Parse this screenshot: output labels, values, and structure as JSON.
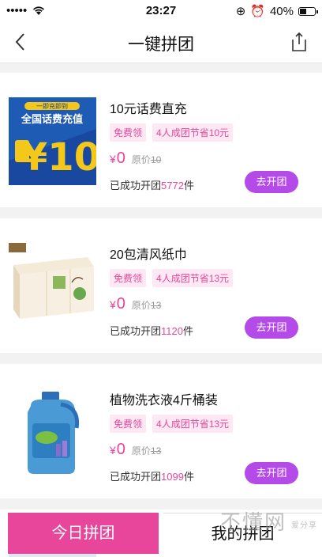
{
  "status_bar": {
    "time": "23:27",
    "battery": "40%"
  },
  "header": {
    "title": "一键拼团"
  },
  "items": [
    {
      "title": "10元话费直充",
      "tags": [
        "免费领",
        "4人成团节省10元"
      ],
      "currency": "¥",
      "price": "0",
      "original_label": "原价",
      "original_price": "10",
      "success_prefix": "已成功开团",
      "success_count": "5772",
      "success_suffix": "件",
      "button": "去开团",
      "image_text": {
        "top": "一即充即到",
        "main": "全国话费充值",
        "amount": "¥10"
      }
    },
    {
      "title": "20包清风纸巾",
      "tags": [
        "免费领",
        "4人成团节省13元"
      ],
      "currency": "¥",
      "price": "0",
      "original_label": "原价",
      "original_price": "13",
      "success_prefix": "已成功开团",
      "success_count": "1120",
      "success_suffix": "件",
      "button": "去开团"
    },
    {
      "title": "植物洗衣液4斤桶装",
      "tags": [
        "免费领",
        "4人成团节省13元"
      ],
      "currency": "¥",
      "price": "0",
      "original_label": "原价",
      "original_price": "13",
      "success_prefix": "已成功开团",
      "success_count": "1099",
      "success_suffix": "件",
      "button": "去开团"
    }
  ],
  "bottom": {
    "today": "今日拼团",
    "mine": "我的拼团"
  },
  "watermark": {
    "main": "不懂网",
    "sub": "爱分享"
  },
  "colors": {
    "accent": "#e8469a",
    "button": "#b44ae8",
    "tag_bg": "#fde8f3"
  }
}
